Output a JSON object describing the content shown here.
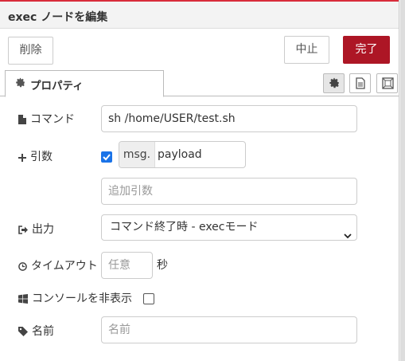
{
  "dialog": {
    "title": "exec ノードを編集",
    "delete_label": "削除",
    "cancel_label": "中止",
    "done_label": "完了",
    "accent_color": "#d82c3b",
    "done_color": "#ad1625"
  },
  "tabs": {
    "active_label": "プロパティ",
    "active_icon": "gear-icon",
    "buttons": [
      {
        "icon": "gear-icon",
        "selected": true
      },
      {
        "icon": "document-icon",
        "selected": false
      },
      {
        "icon": "appearance-icon",
        "selected": false
      }
    ]
  },
  "form": {
    "command": {
      "label": "コマンド",
      "icon": "file-icon",
      "value": "sh /home/USER/test.sh"
    },
    "append": {
      "label": "引数",
      "icon": "plus-icon",
      "checked": true,
      "type_prefix": "msg.",
      "value": "payload",
      "extra_placeholder": "追加引数"
    },
    "output": {
      "label": "出力",
      "icon": "sign-out-icon",
      "selected": "コマンド終了時 - execモード"
    },
    "timeout": {
      "label": "タイムアウト",
      "icon": "clock-icon",
      "placeholder": "任意",
      "unit": "秒"
    },
    "hide_console": {
      "label": "コンソールを非表示",
      "icon": "windows-icon",
      "checked": false
    },
    "name": {
      "label": "名前",
      "icon": "tag-icon",
      "placeholder": "名前"
    }
  }
}
